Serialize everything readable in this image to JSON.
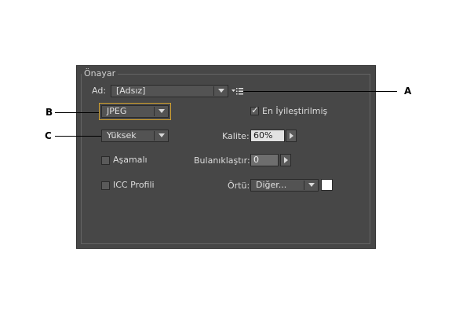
{
  "panel": {
    "title": "Önayar",
    "name_label": "Ad:",
    "name_value": "[Adsız]",
    "format_value": "JPEG",
    "optimized_label": "En İyileştirilmiş",
    "optimized_checked": true,
    "quality_preset_value": "Yüksek",
    "quality_label": "Kalite:",
    "quality_value": "60%",
    "progressive_label": "Aşamalı",
    "progressive_checked": false,
    "blur_label": "Bulanıklaştır:",
    "blur_value": "0",
    "icc_label": "ICC Profili",
    "icc_checked": false,
    "matte_label": "Örtü:",
    "matte_value": "Diğer...",
    "matte_color": "#ffffff"
  },
  "callouts": {
    "a": "A",
    "b": "B",
    "c": "C"
  },
  "colors": {
    "panel_bg": "#474747",
    "highlight": "#d0a030"
  }
}
